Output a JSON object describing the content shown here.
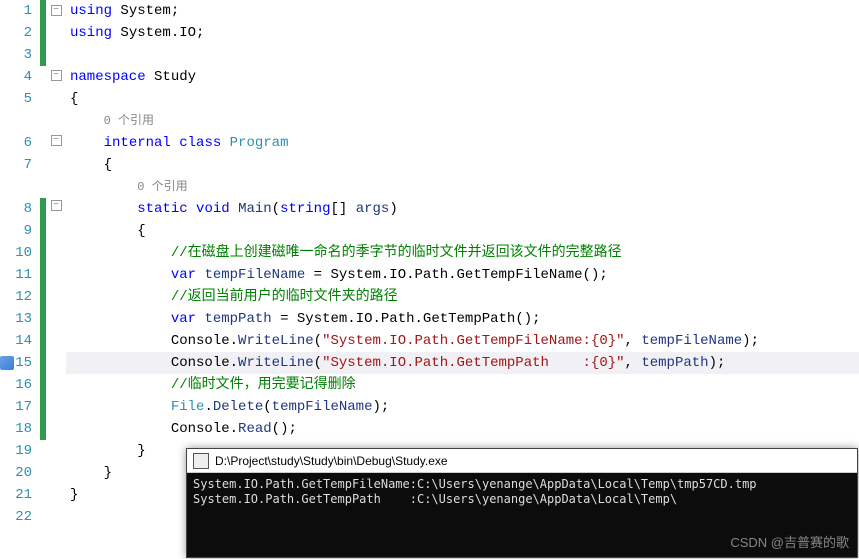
{
  "gutter": {
    "lines": [
      "1",
      "2",
      "3",
      "4",
      "5",
      "",
      "6",
      "7",
      "",
      "8",
      "9",
      "10",
      "11",
      "12",
      "13",
      "14",
      "15",
      "16",
      "17",
      "18",
      "19",
      "20",
      "21",
      "22"
    ]
  },
  "codelens": {
    "refs": "0 个引用"
  },
  "code": {
    "l1": {
      "using": "using",
      "ns": "System",
      "end": ";"
    },
    "l2": {
      "using": "using",
      "ns": "System.IO",
      "end": ";"
    },
    "l4": {
      "kw": "namespace",
      "name": "Study"
    },
    "l5": {
      "brace": "{"
    },
    "l6": {
      "mod": "internal",
      "kw": "class",
      "name": "Program"
    },
    "l7": {
      "brace": "{"
    },
    "l8": {
      "mod": "static",
      "ret": "void",
      "name": "Main",
      "lp": "(",
      "ptype": "string",
      "arr": "[]",
      "pname": "args",
      "rp": ")"
    },
    "l9": {
      "brace": "{"
    },
    "l10": {
      "c": "//在磁盘上创建磁唯一命名的季字节的临时文件并返回该文件的完整路径"
    },
    "l11": {
      "kw": "var",
      "v": "tempFileName",
      "eq": " = ",
      "call": "System.IO.Path.GetTempFileName",
      "after": "();"
    },
    "l12": {
      "c": "//返回当前用户的临时文件夹的路径"
    },
    "l13": {
      "kw": "var",
      "v": "tempPath",
      "eq": " = ",
      "call": "System.IO.Path.GetTempPath",
      "after": "();"
    },
    "l14": {
      "obj": "Console",
      "dot": ".",
      "m": "WriteLine",
      "lp": "(",
      "s": "\"System.IO.Path.GetTempFileName:{0}\"",
      "sep": ", ",
      "arg": "tempFileName",
      "rp": ");"
    },
    "l15": {
      "obj": "Console",
      "dot": ".",
      "m": "WriteLine",
      "lp": "(",
      "s": "\"System.IO.Path.GetTempPath    :{0}\"",
      "sep": ", ",
      "arg": "tempPath",
      "rp": ");"
    },
    "l16": {
      "c": "//临时文件，用完要记得删除"
    },
    "l17": {
      "obj": "File",
      "dot": ".",
      "m": "Delete",
      "lp": "(",
      "arg": "tempFileName",
      "rp": ");"
    },
    "l18": {
      "obj": "Console",
      "dot": ".",
      "m": "Read",
      "lp": "(",
      "rp": ");"
    },
    "l19": {
      "brace": "}"
    },
    "l20": {
      "brace": "}"
    },
    "l21": {
      "brace": "}"
    }
  },
  "console": {
    "title": "D:\\Project\\study\\Study\\bin\\Debug\\Study.exe",
    "out1": "System.IO.Path.GetTempFileName:C:\\Users\\yenange\\AppData\\Local\\Temp\\tmp57CD.tmp",
    "out2": "System.IO.Path.GetTempPath    :C:\\Users\\yenange\\AppData\\Local\\Temp\\"
  },
  "watermark": "CSDN @吉普赛的歌"
}
